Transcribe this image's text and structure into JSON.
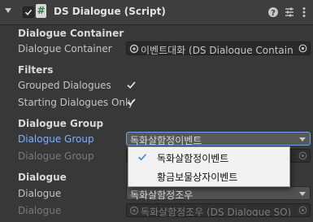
{
  "header": {
    "title": "DS Dialogue (Script)",
    "enabled": true,
    "script_icon_glyph": "#",
    "icons": [
      "help-icon",
      "presets-icon",
      "more-icon"
    ]
  },
  "sections": {
    "container": {
      "title": "Dialogue Container",
      "field_label": "Dialogue Container",
      "field_value": "이벤트대화 (DS Dialogue Container SO)"
    },
    "filters": {
      "title": "Filters",
      "grouped_label": "Grouped Dialogues",
      "grouped_value": true,
      "starting_label": "Starting Dialogues Only",
      "starting_value": true
    },
    "group": {
      "title": "Dialogue Group",
      "popup_label": "Dialogue Group",
      "popup_value": "독화살함정이벤트",
      "object_label": "Dialogue Group",
      "object_value": ""
    },
    "dialogue": {
      "title": "Dialogue",
      "popup_label": "Dialogue",
      "popup_value": "독화살함정조우",
      "object_label": "Dialogue",
      "object_value": "독화살함정조우 (DS Dialogue SO)"
    }
  },
  "dropdown": {
    "options": [
      {
        "label": "독화살함정이벤트",
        "selected": true
      },
      {
        "label": "황금보물상자이벤트",
        "selected": false
      }
    ]
  },
  "colors": {
    "background": "#383838",
    "header": "#3e3e3e",
    "highlight_label": "#7bb1ff",
    "check_accent": "#4a90e2"
  }
}
